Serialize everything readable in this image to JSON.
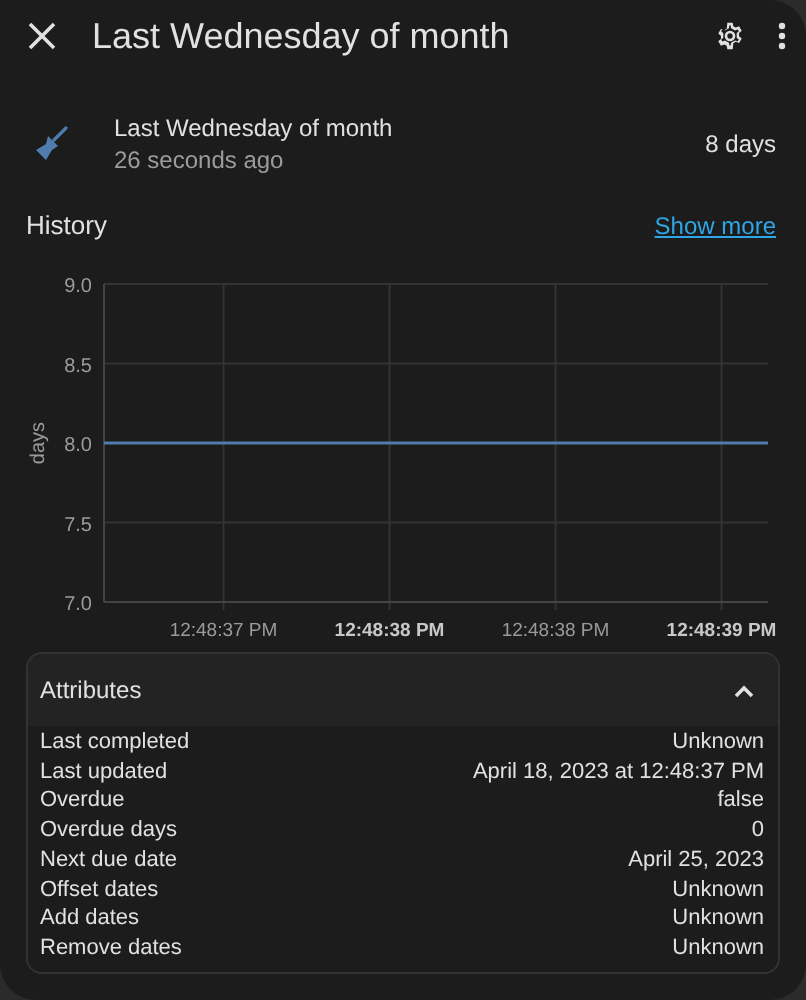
{
  "header": {
    "title": "Last Wednesday of month"
  },
  "entity": {
    "name": "Last Wednesday of month",
    "last_changed": "26 seconds ago",
    "state": "8 days"
  },
  "history": {
    "title": "History",
    "link": "Show more",
    "chart_data": {
      "type": "line",
      "ylabel": "days",
      "grid": true,
      "x": [
        46117.14,
        46119.14
      ],
      "xlim": [
        46117.14,
        46119.14
      ],
      "ylim": [
        7,
        9
      ],
      "yticks": [
        {
          "value": 7,
          "label": "7.0"
        },
        {
          "value": 7.5,
          "label": "7.5"
        },
        {
          "value": 8,
          "label": "8.0"
        },
        {
          "value": 8.5,
          "label": "8.5"
        },
        {
          "value": 9,
          "label": "9.0"
        }
      ],
      "xticks": [
        {
          "value": 46117.5,
          "label": "12:48:37 PM"
        },
        {
          "value": 46118,
          "label": "12:48:38 PM"
        },
        {
          "value": 46118.5,
          "label": "12:48:38 PM"
        },
        {
          "value": 46119,
          "label": "12:48:39 PM"
        }
      ],
      "series": [
        {
          "color": "#4f7cac",
          "values": [
            8,
            8
          ]
        }
      ]
    }
  },
  "attributes": {
    "title": "Attributes",
    "expanded": true,
    "rows": [
      {
        "label": "Last completed",
        "value": "Unknown"
      },
      {
        "label": "Last updated",
        "value": "April 18, 2023 at 12:48:37 PM"
      },
      {
        "label": "Overdue",
        "value": "false"
      },
      {
        "label": "Overdue days",
        "value": "0"
      },
      {
        "label": "Next due date",
        "value": "April 25, 2023"
      },
      {
        "label": "Offset dates",
        "value": "Unknown"
      },
      {
        "label": "Add dates",
        "value": "Unknown"
      },
      {
        "label": "Remove dates",
        "value": "Unknown"
      }
    ]
  }
}
